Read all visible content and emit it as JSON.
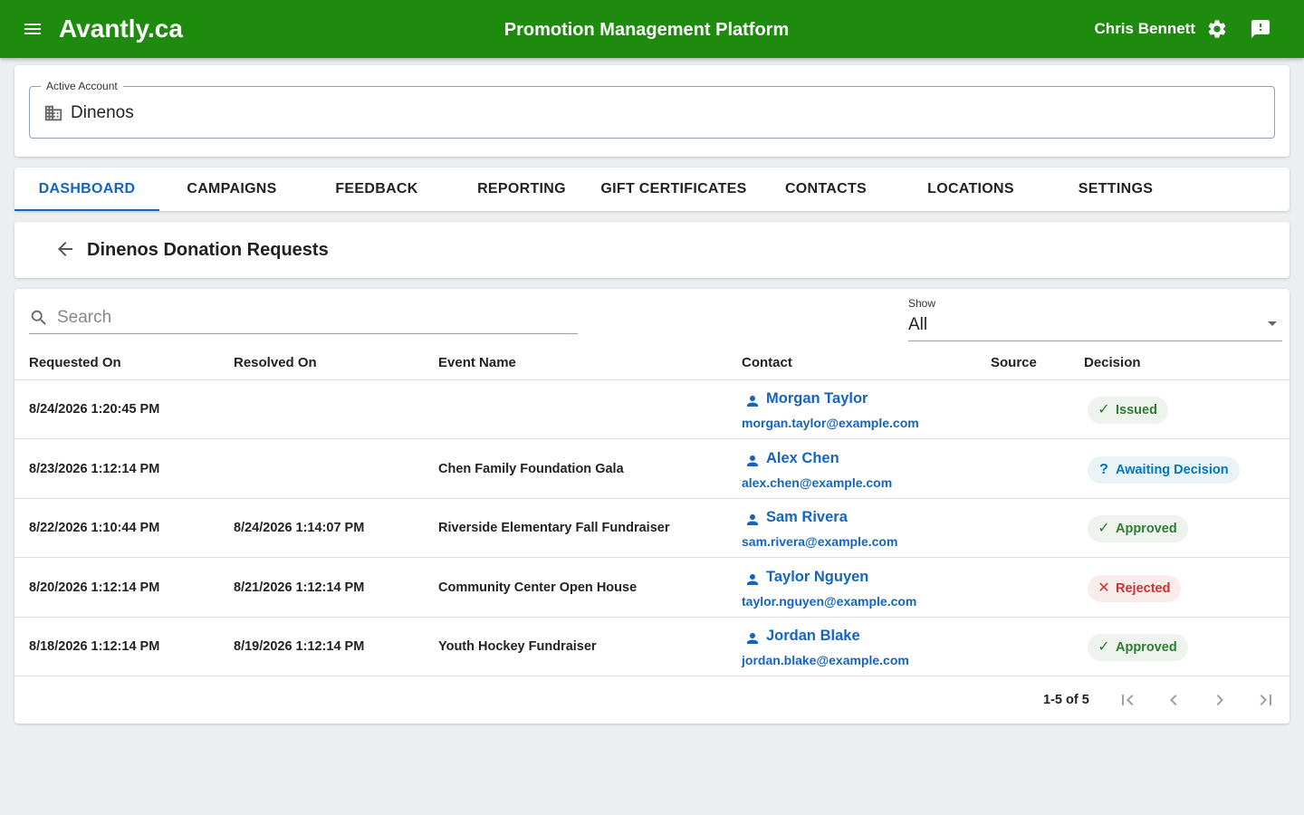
{
  "topbar": {
    "brand": "Avantly.ca",
    "title": "Promotion Management Platform",
    "user": "Chris Bennett",
    "color": "#1e8a0e"
  },
  "account": {
    "label": "Active Account",
    "value": "Dinenos"
  },
  "tabs": [
    {
      "label": "DASHBOARD",
      "active": true
    },
    {
      "label": "CAMPAIGNS",
      "active": false
    },
    {
      "label": "FEEDBACK",
      "active": false
    },
    {
      "label": "REPORTING",
      "active": false
    },
    {
      "label": "GIFT CERTIFICATES",
      "active": false
    },
    {
      "label": "CONTACTS",
      "active": false
    },
    {
      "label": "LOCATIONS",
      "active": false
    },
    {
      "label": "SETTINGS",
      "active": false
    }
  ],
  "page": {
    "title": "Dinenos Donation Requests"
  },
  "search": {
    "placeholder": "Search",
    "value": ""
  },
  "filter": {
    "label": "Show",
    "value": "All"
  },
  "table": {
    "headers": {
      "requested": "Requested On",
      "resolved": "Resolved On",
      "event": "Event Name",
      "contact": "Contact",
      "source": "Source",
      "decision": "Decision"
    },
    "rows": [
      {
        "requested": "8/24/2026 1:20:45 PM",
        "resolved": "",
        "event": "",
        "contact_name": "Morgan Taylor",
        "contact_email": "morgan.taylor@example.com",
        "source": "",
        "decision": "Issued",
        "status": "issued"
      },
      {
        "requested": "8/23/2026 1:12:14 PM",
        "resolved": "",
        "event": "Chen Family Foundation Gala",
        "contact_name": "Alex Chen",
        "contact_email": "alex.chen@example.com",
        "source": "",
        "decision": "Awaiting Decision",
        "status": "awaiting"
      },
      {
        "requested": "8/22/2026 1:10:44 PM",
        "resolved": "8/24/2026 1:14:07 PM",
        "event": "Riverside Elementary Fall Fundraiser",
        "contact_name": "Sam Rivera",
        "contact_email": "sam.rivera@example.com",
        "source": "",
        "decision": "Approved",
        "status": "approved"
      },
      {
        "requested": "8/20/2026 1:12:14 PM",
        "resolved": "8/21/2026 1:12:14 PM",
        "event": "Community Center Open House",
        "contact_name": "Taylor Nguyen",
        "contact_email": "taylor.nguyen@example.com",
        "source": "",
        "decision": "Rejected",
        "status": "rejected"
      },
      {
        "requested": "8/18/2026 1:12:14 PM",
        "resolved": "8/19/2026 1:12:14 PM",
        "event": "Youth Hockey Fundraiser",
        "contact_name": "Jordan Blake",
        "contact_email": "jordan.blake@example.com",
        "source": "",
        "decision": "Approved",
        "status": "approved"
      }
    ]
  },
  "status_styles": {
    "issued": {
      "icon": "check-icon",
      "glyph": "✓",
      "color": "#2e7d32",
      "bg": "#eef3ee"
    },
    "awaiting": {
      "icon": "question-icon",
      "glyph": "?",
      "color": "#0277bd",
      "bg": "#eaf3f8"
    },
    "approved": {
      "icon": "check-icon",
      "glyph": "✓",
      "color": "#2e7d32",
      "bg": "#eef3ee"
    },
    "rejected": {
      "icon": "close-icon",
      "glyph": "✕",
      "color": "#d32f2f",
      "bg": "#fbecec"
    }
  },
  "pagination": {
    "range": "1-5 of 5"
  },
  "colors": {
    "accent": "#1565c0"
  }
}
